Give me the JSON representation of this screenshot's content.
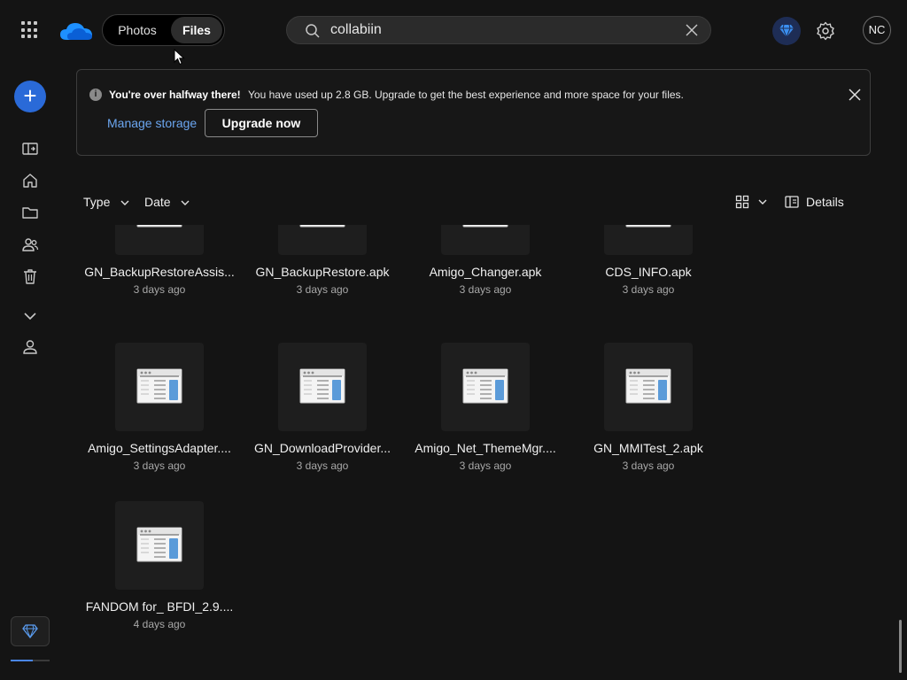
{
  "header": {
    "tabs": [
      {
        "label": "Photos"
      },
      {
        "label": "Files"
      }
    ],
    "search": {
      "value": "collabiin"
    },
    "avatar_initials": "NC"
  },
  "sidebar": {
    "new_label": "+",
    "items": [
      {
        "icon": "my-files-icon"
      },
      {
        "icon": "home-icon"
      },
      {
        "icon": "folder-icon"
      },
      {
        "icon": "shared-people-icon"
      },
      {
        "icon": "recycle-bin-icon"
      },
      {
        "icon": "chevron-down-icon"
      },
      {
        "icon": "person-icon"
      }
    ],
    "storage_progress": 0.56
  },
  "banner": {
    "title": "You're over halfway there!",
    "message": "You have used up 2.8 GB. Upgrade to get the best experience and more space for your files.",
    "manage_label": "Manage storage",
    "upgrade_label": "Upgrade now"
  },
  "toolbar": {
    "type_label": "Type",
    "date_label": "Date",
    "details_label": "Details"
  },
  "files": [
    {
      "name": "GN_BackupRestoreAssis...",
      "modified": "3 days ago"
    },
    {
      "name": "GN_BackupRestore.apk",
      "modified": "3 days ago"
    },
    {
      "name": "Amigo_Changer.apk",
      "modified": "3 days ago"
    },
    {
      "name": "CDS_INFO.apk",
      "modified": "3 days ago"
    },
    {
      "name": "Amigo_SettingsAdapter....",
      "modified": "3 days ago"
    },
    {
      "name": "GN_DownloadProvider...",
      "modified": "3 days ago"
    },
    {
      "name": "Amigo_Net_ThemeMgr....",
      "modified": "3 days ago"
    },
    {
      "name": "GN_MMITest_2.apk",
      "modified": "3 days ago"
    },
    {
      "name": "FANDOM for_ BFDI_2.9....",
      "modified": "4 days ago"
    }
  ],
  "colors": {
    "background": "#141414",
    "accent": "#2a6ad8",
    "link": "#6ba6f0"
  }
}
